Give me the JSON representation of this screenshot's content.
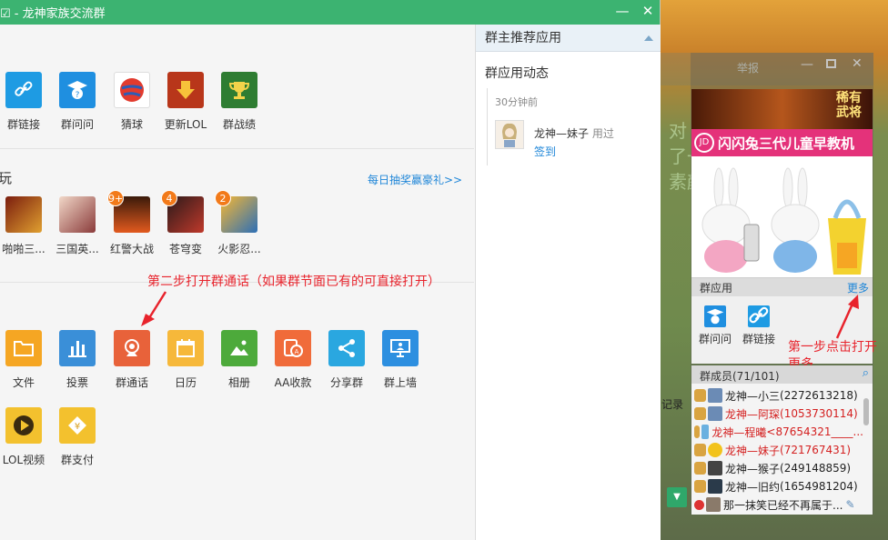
{
  "window": {
    "title": "☑ - 龙神家族交流群",
    "min": "—",
    "close": "✕"
  },
  "apps_row1": [
    {
      "label": "群链接",
      "icon": "link-icon",
      "color": "#1e9be3"
    },
    {
      "label": "群问问",
      "icon": "question-cap-icon",
      "color": "#1f8fe0"
    },
    {
      "label": "猜球",
      "icon": "ball-icon",
      "color": "#e23b2e"
    },
    {
      "label": "更新LOL",
      "icon": "download-arrow-icon",
      "color": "#d9461c"
    },
    {
      "label": "群战绩",
      "icon": "trophy-icon",
      "color": "#2e8b32"
    }
  ],
  "games": {
    "title": "玩",
    "link": "每日抽奖赢豪礼>>",
    "items": [
      {
        "label": "啪啪三...",
        "badge": ""
      },
      {
        "label": "三国英...",
        "badge": ""
      },
      {
        "label": "红警大战",
        "badge": "9+"
      },
      {
        "label": "苍穹变",
        "badge": "4"
      },
      {
        "label": "火影忍...",
        "badge": "2"
      }
    ]
  },
  "annotation_step2": "第二步打开群通话（如果群节面已有的可直接打开）",
  "tools_row1": [
    {
      "label": "文件",
      "icon": "folder-icon",
      "color": "#f5a623"
    },
    {
      "label": "投票",
      "icon": "bar-chart-icon",
      "color": "#3a8fd8"
    },
    {
      "label": "群通话",
      "icon": "webcam-icon",
      "color": "#e8623a"
    },
    {
      "label": "日历",
      "icon": "calendar-icon",
      "color": "#f6b83a"
    },
    {
      "label": "相册",
      "icon": "photo-icon",
      "color": "#4daa3b"
    },
    {
      "label": "AA收款",
      "icon": "aa-payment-icon",
      "color": "#f06b3a"
    },
    {
      "label": "分享群",
      "icon": "share-icon",
      "color": "#2aa7e0"
    },
    {
      "label": "群上墙",
      "icon": "presentation-icon",
      "color": "#2d8fe0"
    }
  ],
  "tools_row2": [
    {
      "label": "LOL视频",
      "icon": "play-icon",
      "color": "#f3c12e"
    },
    {
      "label": "群支付",
      "icon": "yen-wallet-icon",
      "color": "#f3c12e"
    }
  ],
  "sidebar": {
    "header": "群主推荐应用",
    "dynamics_title": "群应用动态",
    "time": "30分钟前",
    "activity_user": "龙神—妹子",
    "activity_action": "用过",
    "activity_link": "签到"
  },
  "chat": {
    "report": "举报",
    "ad_title": "稀有武将",
    "ad_brand": "JD",
    "ad_text": "闪闪兔三代儿童早教机",
    "apps_title": "群应用",
    "apps_more": "更多",
    "apps": [
      {
        "label": "群问问",
        "icon": "question-cap-icon"
      },
      {
        "label": "群链接",
        "icon": "link-icon"
      }
    ],
    "annotation_step1": "第一步点击打开更多",
    "members_title": "群成员(71/101)",
    "members": [
      {
        "name": "龙神—小三",
        "qq": "(2272613218)",
        "color": "#222"
      },
      {
        "name": "龙神—阿琛",
        "qq": "(1053730114)",
        "color": "#d42020"
      },
      {
        "name": "龙神—程曦",
        "qq": "<87654321____...",
        "color": "#d42020"
      },
      {
        "name": "龙神—妹子",
        "qq": "(721767431)",
        "color": "#d42020"
      },
      {
        "name": "龙神—猴子",
        "qq": "(249148859)",
        "color": "#222"
      },
      {
        "name": "龙神—旧约",
        "qq": "(1654981204)",
        "color": "#222"
      },
      {
        "name": "那一抹笑已经不再属于...",
        "qq": "",
        "color": "#222"
      }
    ],
    "record": "记录"
  }
}
